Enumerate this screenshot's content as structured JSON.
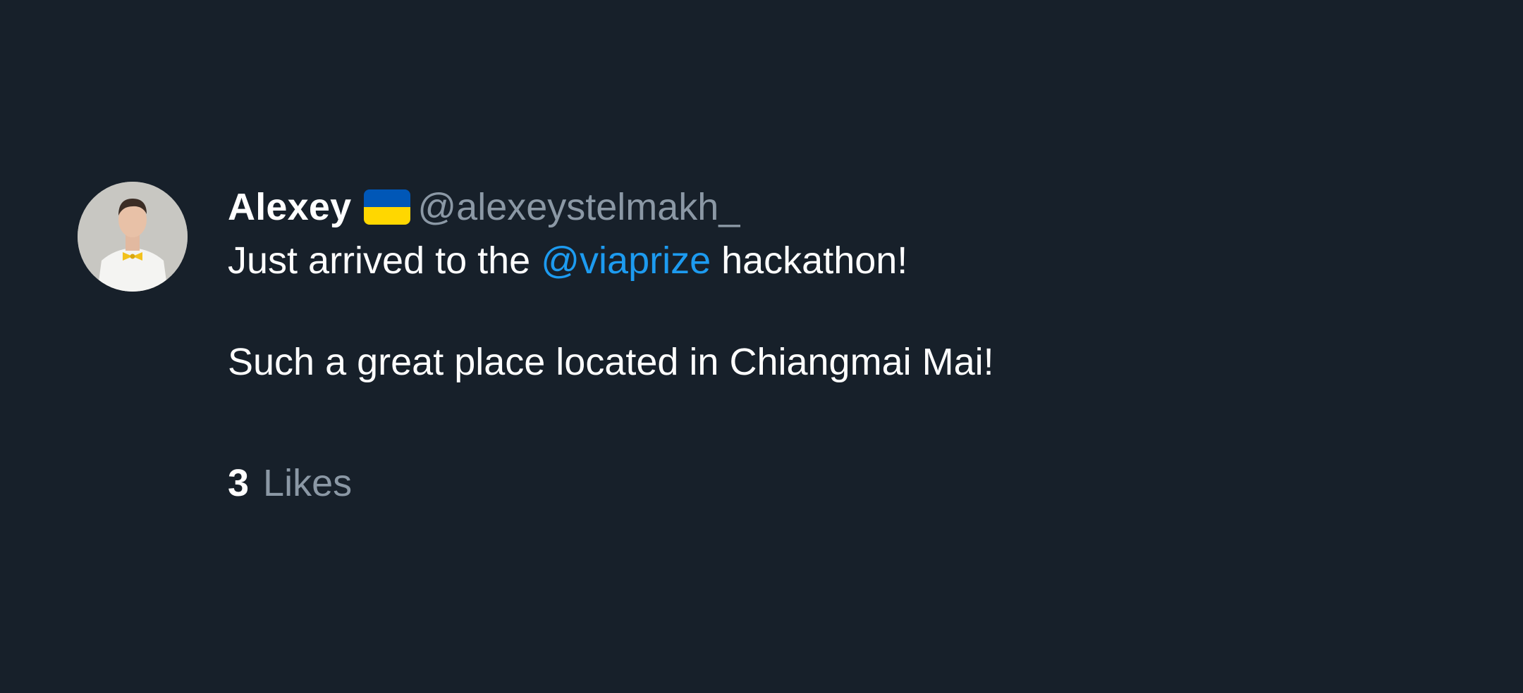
{
  "tweet": {
    "author": {
      "name": "Alexey",
      "handle": "@alexeystelmakh_",
      "flag_icon": "ukraine-flag-icon",
      "flag_colors": [
        "#0057b7",
        "#ffd700"
      ]
    },
    "text": {
      "line1_before": "Just arrived to the ",
      "mention": "@viaprize",
      "line1_after": " hackathon!",
      "line2": "Such a great place located in Chiangmai Mai!"
    },
    "likes": {
      "count": "3",
      "label": "Likes"
    }
  },
  "colors": {
    "background": "#17202a",
    "text": "#ffffff",
    "muted": "#8b98a5",
    "accent": "#1d9bf0"
  }
}
